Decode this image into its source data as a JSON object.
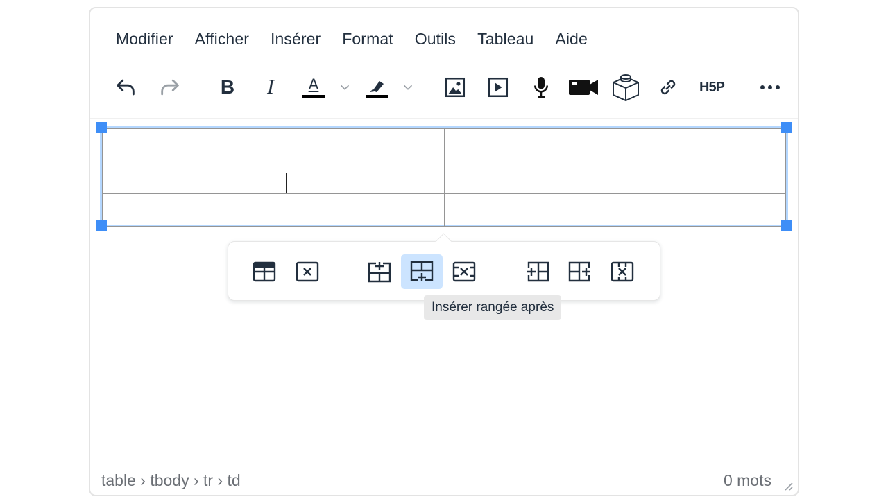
{
  "menubar": {
    "items": [
      "Modifier",
      "Afficher",
      "Insérer",
      "Format",
      "Outils",
      "Tableau",
      "Aide"
    ]
  },
  "toolbar": {
    "buttons": [
      {
        "name": "undo-icon"
      },
      {
        "name": "redo-icon",
        "disabled": true
      },
      {
        "name": "bold-icon",
        "label": "B"
      },
      {
        "name": "italic-icon",
        "label": "I"
      },
      {
        "name": "text-color-icon",
        "label": "A",
        "color": "#000000"
      },
      {
        "name": "highlight-icon",
        "color": "#000000"
      },
      {
        "name": "image-icon"
      },
      {
        "name": "media-icon"
      },
      {
        "name": "microphone-icon"
      },
      {
        "name": "video-camera-icon"
      },
      {
        "name": "3d-box-icon"
      },
      {
        "name": "link-icon"
      },
      {
        "name": "h5p-icon",
        "label": "H5P"
      },
      {
        "name": "more-icon"
      }
    ]
  },
  "table": {
    "rows": 3,
    "cols": 4,
    "selection_color": "#b4d7ff",
    "handle_color": "#3e8ef7"
  },
  "table_context_toolbar": {
    "buttons": [
      "table-properties-icon",
      "delete-table-icon",
      "insert-row-before-icon",
      "insert-row-after-icon",
      "delete-row-icon",
      "insert-column-before-icon",
      "insert-column-after-icon",
      "delete-column-icon"
    ],
    "active": "insert-row-after-icon",
    "tooltip": "Insérer rangée après"
  },
  "statusbar": {
    "path": "table › tbody › tr › td",
    "wordcount": "0 mots"
  },
  "colors": {
    "text": "#222f3e",
    "accent": "#3e8ef7",
    "active_bg": "#cce4ff"
  }
}
